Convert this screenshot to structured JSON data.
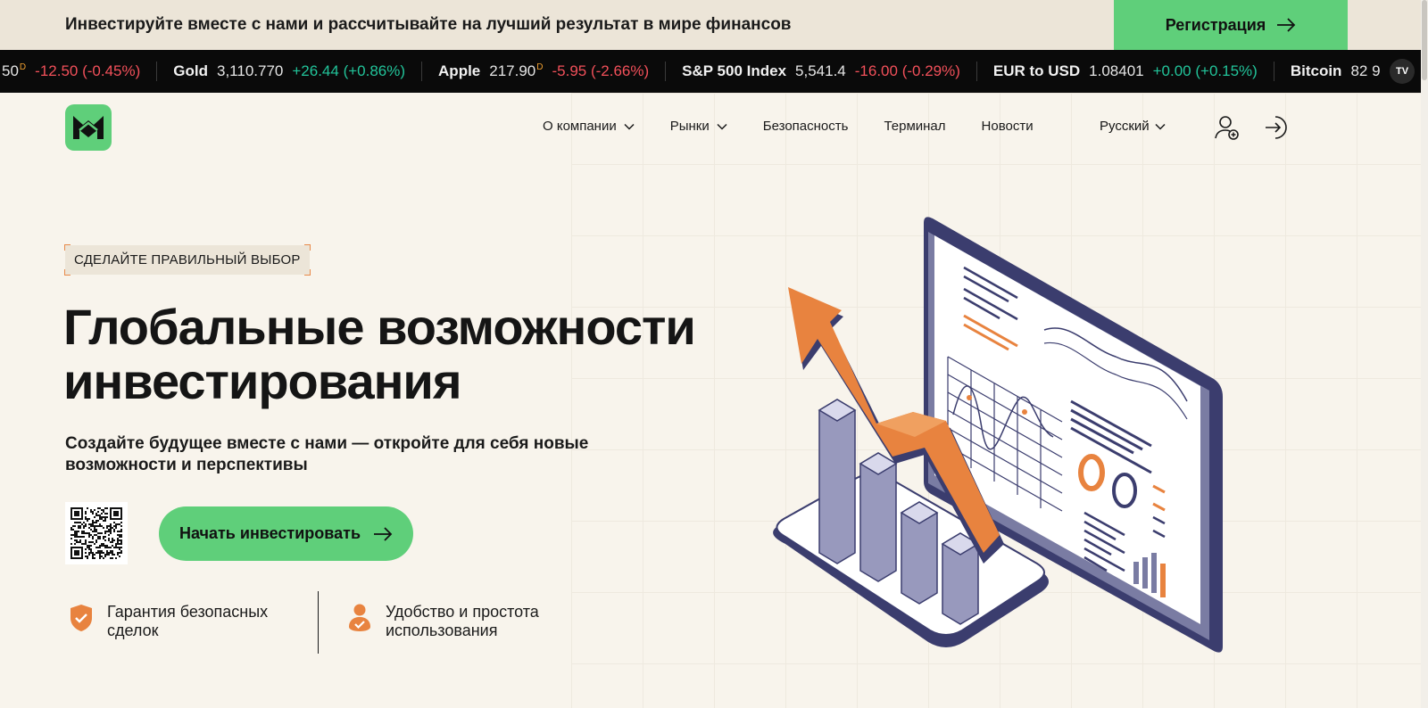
{
  "promo": {
    "text": "Инвестируйте вместе с нами и рассчитывайте на лучший результат в мире финансов",
    "register_label": "Регистрация"
  },
  "ticker": {
    "items": [
      {
        "name": "",
        "price": "50",
        "flag": "D",
        "change": "-12.50 (-0.45%)",
        "dir": "neg"
      },
      {
        "name": "Gold",
        "price": "3,110.770",
        "flag": "",
        "change": "+26.44 (+0.86%)",
        "dir": "pos"
      },
      {
        "name": "Apple",
        "price": "217.90",
        "flag": "D",
        "change": "-5.95 (-2.66%)",
        "dir": "neg"
      },
      {
        "name": "S&P 500 Index",
        "price": "5,541.4",
        "flag": "",
        "change": "-16.00 (-0.29%)",
        "dir": "neg"
      },
      {
        "name": "EUR to USD",
        "price": "1.08401",
        "flag": "",
        "change": "+0.00 (+0.15%)",
        "dir": "pos"
      },
      {
        "name": "Bitcoin",
        "price": "82 9",
        "flag": "",
        "change": "",
        "dir": "pos"
      }
    ],
    "badge": "TV"
  },
  "nav": {
    "about": "О компании",
    "markets": "Рынки",
    "security": "Безопасность",
    "terminal": "Терминал",
    "news": "Новости",
    "language": "Русский"
  },
  "hero": {
    "badge": "СДЕЛАЙТЕ ПРАВИЛЬНЫЙ ВЫБОР",
    "title_line1": "Глобальные возможности",
    "title_line2": "инвестирования",
    "subtitle": "Создайте будущее вместе с нами — откройте для себя новые возможности и перспективы",
    "cta_label": "Начать инвестировать"
  },
  "features": [
    {
      "text": "Гарантия безопасных сделок",
      "icon": "shield-check-icon"
    },
    {
      "text": "Удобство и простота использования",
      "icon": "user-check-icon"
    }
  ],
  "colors": {
    "accent_green": "#5fcf7a",
    "accent_orange": "#e8833f",
    "background": "#f8f4ec",
    "ticker_bg": "#0a0a0a",
    "negative": "#f2505a",
    "positive": "#22c49a"
  }
}
